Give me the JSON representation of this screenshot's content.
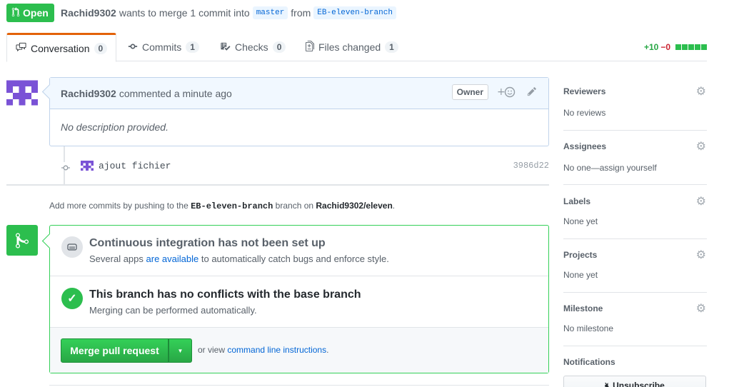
{
  "header": {
    "state_label": "Open",
    "author": "Rachid9302",
    "merge_text": "wants to merge 1 commit into",
    "base_branch": "master",
    "from_text": "from",
    "head_branch": "EB-eleven-branch"
  },
  "tabs": [
    {
      "label": "Conversation",
      "count": "0",
      "icon": "comment-discussion-icon"
    },
    {
      "label": "Commits",
      "count": "1",
      "icon": "git-commit-icon"
    },
    {
      "label": "Checks",
      "count": "0",
      "icon": "checklist-icon"
    },
    {
      "label": "Files changed",
      "count": "1",
      "icon": "file-diff-icon"
    }
  ],
  "diffstat": {
    "additions": "+10",
    "deletions": "−0"
  },
  "comment": {
    "author": "Rachid9302",
    "action": "commented a minute ago",
    "badge": "Owner",
    "body": "No description provided."
  },
  "commit": {
    "message": "ajout fichier",
    "sha": "3986d22"
  },
  "push_hint": {
    "prefix": "Add more commits by pushing to the",
    "branch": "EB-eleven-branch",
    "middle": "branch on",
    "repo": "Rachid9302/eleven",
    "suffix": "."
  },
  "mergebox": {
    "ci_title": "Continuous integration has not been set up",
    "ci_sub_pre": "Several apps",
    "ci_sub_link": "are available",
    "ci_sub_post": "to automatically catch bugs and enforce style.",
    "ok_title": "This branch has no conflicts with the base branch",
    "ok_sub": "Merging can be performed automatically.",
    "merge_label": "Merge pull request",
    "alt_pre": "or view",
    "alt_link": "command line instructions",
    "alt_post": "."
  },
  "sidebar": {
    "reviewers": {
      "title": "Reviewers",
      "value": "No reviews"
    },
    "assignees": {
      "title": "Assignees",
      "value": "No one—assign yourself"
    },
    "labels": {
      "title": "Labels",
      "value": "None yet"
    },
    "projects": {
      "title": "Projects",
      "value": "None yet"
    },
    "milestone": {
      "title": "Milestone",
      "value": "No milestone"
    },
    "notifications": {
      "title": "Notifications",
      "button": "Unsubscribe"
    }
  },
  "colors": {
    "open_green": "#2cbe4e",
    "link_blue": "#0366d6",
    "tab_accent": "#e36209"
  }
}
